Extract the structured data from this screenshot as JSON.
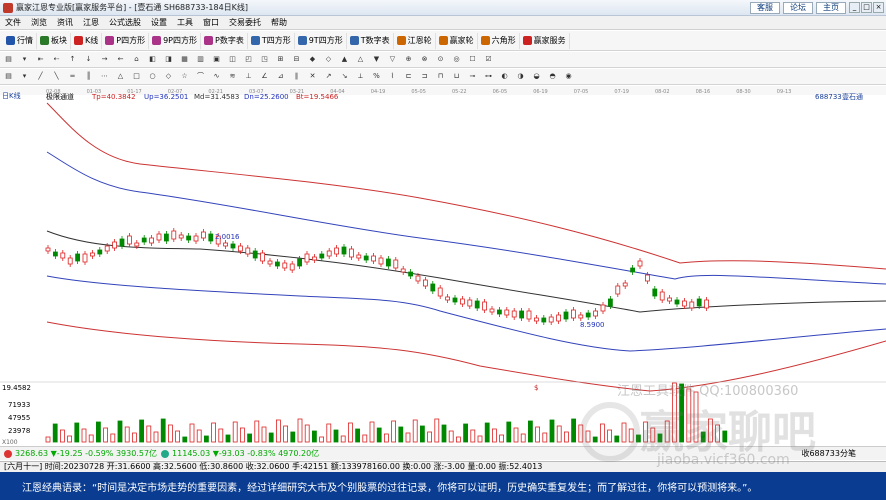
{
  "titlebar": {
    "title": "赢家江恩专业版[赢家服务平台] - [壹石通  SH688733-184日K线]",
    "links": [
      "客服",
      "论坛",
      "主页"
    ],
    "window_buttons": [
      "_",
      "□",
      "×"
    ]
  },
  "menu": [
    "文件",
    "浏览",
    "资讯",
    "江恩",
    "公式选股",
    "设置",
    "工具",
    "窗口",
    "交易委托",
    "帮助"
  ],
  "toolbar1": [
    {
      "label": "行情",
      "color": "#2255aa"
    },
    {
      "label": "板块",
      "color": "#2a7a2a"
    },
    {
      "label": "K线",
      "color": "#cc2222"
    },
    {
      "label": "P四方形",
      "color": "#aa3388"
    },
    {
      "label": "9P四方形",
      "color": "#aa3388"
    },
    {
      "label": "P数字表",
      "color": "#aa3388"
    },
    {
      "label": "T四方形",
      "color": "#3366aa"
    },
    {
      "label": "9T四方形",
      "color": "#3366aa"
    },
    {
      "label": "T数字表",
      "color": "#3366aa"
    },
    {
      "label": "江恩轮",
      "color": "#cc6600"
    },
    {
      "label": "赢家轮",
      "color": "#cc6600"
    },
    {
      "label": "六角形",
      "color": "#cc6600"
    },
    {
      "label": "赢家服务",
      "color": "#cc2222"
    }
  ],
  "chart": {
    "period_label": "日K线",
    "indicator_name": "极限通道",
    "tp": "Tp=40.3842",
    "up": "Up=36.2501",
    "md": "Md=31.4583",
    "dn": "Dn=25.2600",
    "bt": "Bt=19.5466",
    "stock_code": "688733",
    "stock_name": "壹石通",
    "date_ticks": [
      "02-08",
      "01-03",
      "01-17",
      "02-07",
      "02-21",
      "03-07",
      "03-21",
      "04-04",
      "04-19",
      "05-05",
      "05-22",
      "06-05",
      "06-19",
      "07-05",
      "07-19",
      "08-02",
      "08-16",
      "08-30",
      "09-13"
    ],
    "high_label": "2.0016",
    "low_label": "8.5900",
    "vol_axis": [
      "19.4582",
      "71933",
      "47955",
      "23978"
    ],
    "vol_unit": "X100"
  },
  "status": {
    "idx1": "3268.63 ▼-19.25 -0.59% 3930.57亿",
    "idx2": "11145.03 ▼-93.03 -0.83% 4970.20亿",
    "right": "收688733分笔"
  },
  "infobar": "[六月十一] 时间:20230728 开:31.6600 高:32.5600 低:30.8600 收:32.0600 手:42151 额:133978160.00 换:0.00 涨:-3.00 量:0.00 振:52.4013",
  "quote": "江恩经典语录：“时间是决定市场走势的重要因素，经过详细研究大市及个别股票的过往记录，你将可以证明，历史确实重复发生；而了解过往，你将可以预测将来。”。",
  "watermark": {
    "line1": "江恩工具软件 QQ:100800360",
    "line2": "赢家聊吧",
    "line3": "jiaoba.vicf360.com"
  }
}
